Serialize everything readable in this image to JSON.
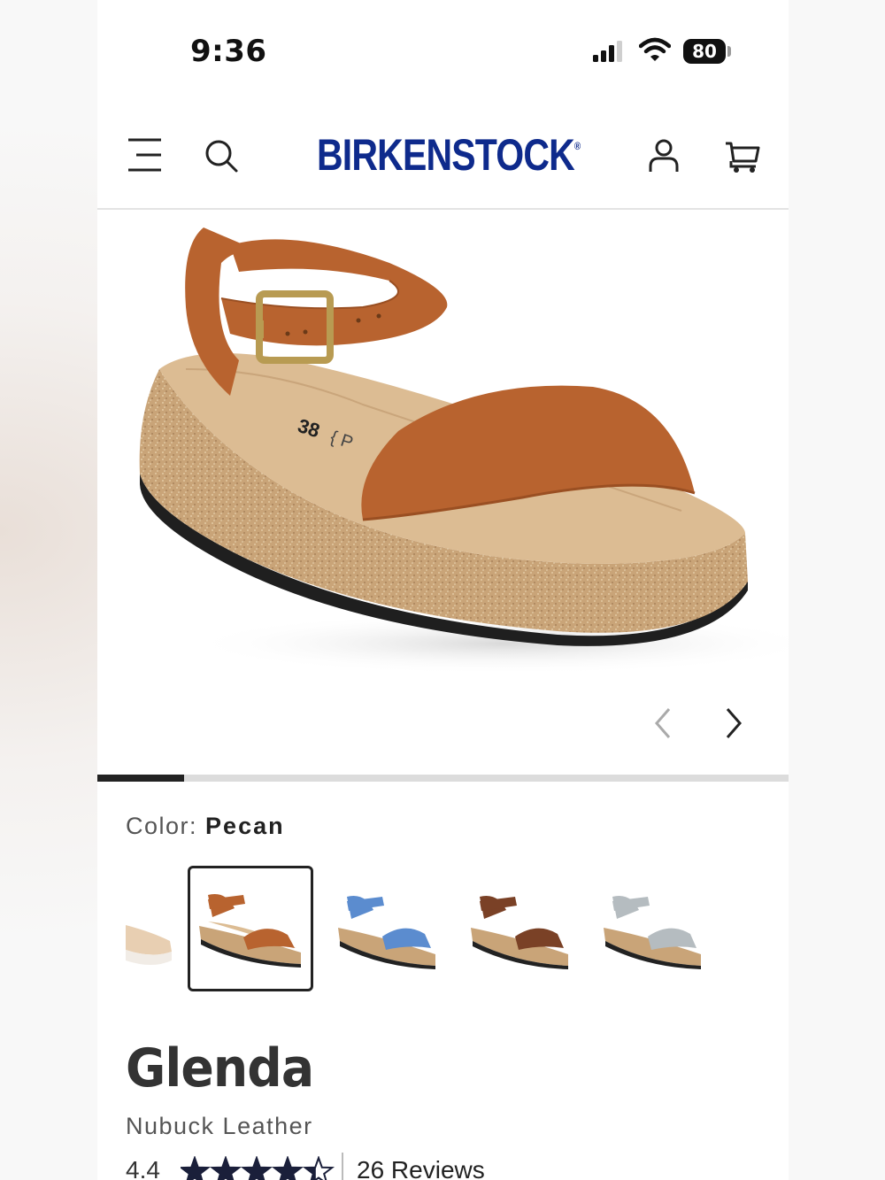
{
  "status_bar": {
    "time": "9:36",
    "battery": "80"
  },
  "header": {
    "brand": "BIRKENSTOCK",
    "icons": [
      "menu-icon",
      "search-icon",
      "account-icon",
      "cart-icon"
    ]
  },
  "gallery": {
    "slide_fraction": 0.125
  },
  "color": {
    "label": "Color:",
    "value": "Pecan"
  },
  "swatches": [
    {
      "name": "partial-cream",
      "strap": "#e8cfb2",
      "selected": false
    },
    {
      "name": "pecan",
      "strap": "#b8632f",
      "selected": true
    },
    {
      "name": "blue",
      "strap": "#5b8ccf",
      "selected": false
    },
    {
      "name": "brown",
      "strap": "#7a4126",
      "selected": false
    },
    {
      "name": "grey",
      "strap": "#b5bcc0",
      "selected": false
    }
  ],
  "product": {
    "name": "Glenda",
    "material": "Nubuck Leather",
    "rating": "4.4",
    "rating_value": 4.4,
    "reviews": "26 Reviews"
  },
  "colors": {
    "brand": "#0e2a8c",
    "strap": "#b8632f",
    "cork": "#c9a478"
  }
}
